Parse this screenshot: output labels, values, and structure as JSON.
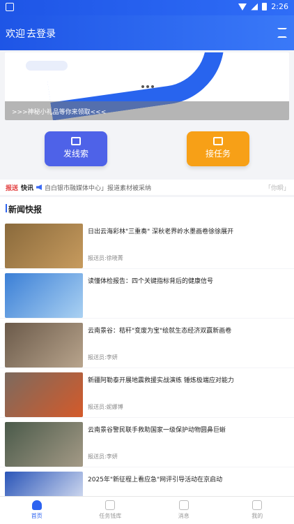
{
  "status": {
    "time": "2:26"
  },
  "header": {
    "welcome": "欢迎",
    "login": "去登录"
  },
  "banner": {
    "caption": ">>>神秘小礼品等你来领取<<<"
  },
  "actions": {
    "clue": "发线索",
    "task": "接任务"
  },
  "ticker": {
    "tag_red": "报送",
    "tag_black": "快讯",
    "text": "自白银市融媒体中心」报道素材被采纳",
    "more": "「你瞬」"
  },
  "section": {
    "title": "新闻快报"
  },
  "news": [
    {
      "title": "日出云海彩林\"三重奏\" 深秋老界岭水墨画卷徐徐展开",
      "reporter": "报送员:徐晓菁",
      "colors": [
        "#8a6a3c",
        "#c79b5e"
      ]
    },
    {
      "title": "读懂体检报告：四个关键指标背后的健康信号",
      "reporter": "",
      "colors": [
        "#3b7fd6",
        "#aad1f2"
      ]
    },
    {
      "title": "云南景谷：秸秆\"变废为宝\"绘就生态经济双赢新画卷",
      "reporter": "报送员:李妍",
      "colors": [
        "#6b5a4a",
        "#b8a48c"
      ]
    },
    {
      "title": "新疆阿勒泰开展地震救援实战演练 锤炼极端应对能力",
      "reporter": "报送员:妮娜博",
      "colors": [
        "#7c6a5e",
        "#d45a2a"
      ]
    },
    {
      "title": "云南景谷警民联手救助国家一级保护动物圆鼻巨蜥",
      "reporter": "报送员:李妍",
      "colors": [
        "#4a5a4a",
        "#a49a86"
      ]
    },
    {
      "title": "2025年\"新征程上看应急\"网评引导活动在京启动",
      "reporter": "",
      "colors": [
        "#2a55b8",
        "#eaeef8"
      ]
    }
  ],
  "tabs": [
    "首页",
    "任务钱库",
    "消息",
    "我的"
  ]
}
